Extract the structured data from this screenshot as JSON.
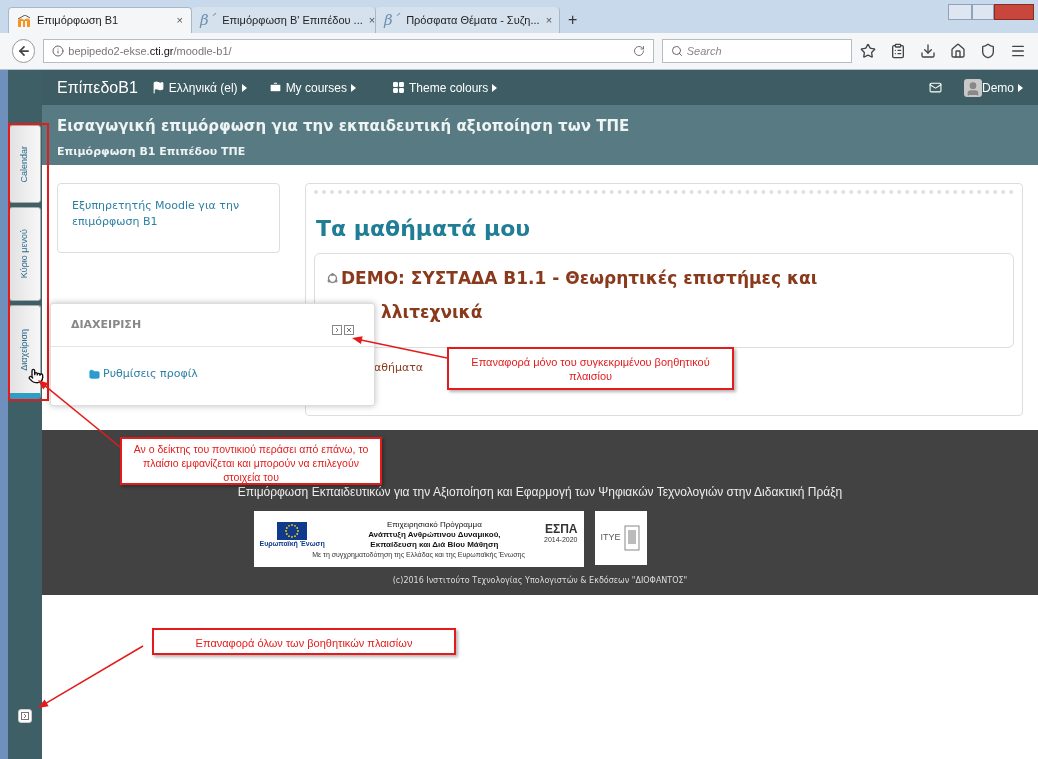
{
  "browser": {
    "tabs": [
      {
        "label": "Επιμόρφωση Β1",
        "kind": "moodle",
        "selected": true
      },
      {
        "label": "Επιμόρφωση Β' Επιπέδου ...",
        "kind": "glyph",
        "glyph": "β΄",
        "selected": false
      },
      {
        "label": "Πρόσφατα Θέματα - Συζη...",
        "kind": "glyph",
        "glyph": "β΄",
        "selected": false
      }
    ],
    "close_glyph": "×",
    "new_tab": "+",
    "url_prefix": "bepipedo2-ekse.",
    "url_domain": "cti.gr",
    "url_path": "/moodle-b1/",
    "search_placeholder": "Search"
  },
  "navbar": {
    "brand": "ΕπίπεδοΒ1",
    "menus": [
      {
        "label": "Ελληνικά (el)",
        "kind": "flag"
      },
      {
        "label": "My courses",
        "kind": "briefcase"
      },
      {
        "label": "Theme colours",
        "kind": "grid"
      }
    ],
    "user": "Demo"
  },
  "header": {
    "title": "Εισαγωγική επιμόρφωση για την εκπαιδευτική αξιοποίηση των ΤΠΕ",
    "subtitle": "Επιμόρφωση Β1 Επιπέδου ΤΠΕ"
  },
  "dock": {
    "tabs": [
      {
        "label": "Calendar",
        "selected": false
      },
      {
        "label": "Κύριο μενού",
        "selected": false
      },
      {
        "label": "Διαχείριση",
        "selected": true
      }
    ]
  },
  "left_block": {
    "text": "Εξυπηρετητής Moodle για την επιμόρφωση Β1"
  },
  "main": {
    "heading": "Τα μαθήματά μου",
    "course_title_lines": [
      "DEMO: ΣΥΣΤΑΔΑ Β1.1 - Θεωρητικές επιστήμες και",
      "λλιτεχνικά"
    ],
    "courses_link": "αθήματα"
  },
  "popup": {
    "title": "ΔΙΑΧΕΙΡΙΣΗ",
    "items": [
      "Ρυθμίσεις προφίλ"
    ]
  },
  "footer": {
    "text": "Επιμόρφωση Εκπαιδευτικών για την Αξιοποίηση και Εφαρμογή των Ψηφιακών Τεχνολογιών στην Διδακτική Πράξη",
    "logo": {
      "eu": "Ευρωπαϊκή Ένωση",
      "program_lines": [
        "Επιχειρησιακό Πρόγραμμα",
        "Ανάπτυξη Ανθρώπινου Δυναμικού,",
        "Εκπαίδευση και Διά Βίου Μάθηση"
      ],
      "cofunding": "Με τη συγχρηματοδότηση της Ελλάδας και της Ευρωπαϊκής Ένωσης",
      "espa": "ΕΣΠΑ",
      "espa_years": "2014-2020",
      "itye": "ΙΤΥΕ"
    },
    "copyright": "(c)2016 Ινστιτούτο Τεχνολογίας Υπολογιστών & Εκδόσεων \"ΔΙΟΦΑΝΤΟΣ\""
  },
  "annotations": [
    {
      "text": "Επαναφορά μόνο του συγκεκριμένου βοηθητικού πλαισίου"
    },
    {
      "text": "Αν ο δείκτης του ποντικιού περάσει από επάνω, το πλαίσιο εμφανίζεται και μπορούν να επιλεγούν στοιχεία του"
    },
    {
      "text": "Επαναφορά όλων των βοηθητικών πλαισίων"
    }
  ]
}
